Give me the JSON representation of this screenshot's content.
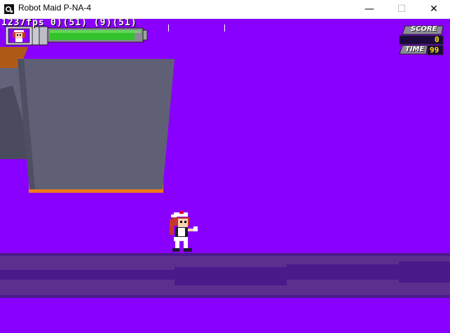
{
  "window": {
    "title": "Robot Maid P-NA-4",
    "minimize_glyph": "—",
    "maximize_glyph": "☐",
    "close_glyph": "✕"
  },
  "hud": {
    "fps_text": "1237fps",
    "debug_values": "0)(51)  (9)(51)",
    "health_level": 0.93,
    "score_label": "SCORE",
    "score_value": "0",
    "time_label": "TIME",
    "time_value": "99"
  },
  "colors": {
    "sky": "#8a00ff",
    "block": "#5f6075",
    "block_trim": "#ee7a1c",
    "floor_light": "#5c2f8f",
    "floor_dark": "#4a1a8a",
    "health_green": "#33c22b"
  },
  "icons": {
    "app": "app-icon",
    "player_portrait": "maid-portrait-icon"
  }
}
